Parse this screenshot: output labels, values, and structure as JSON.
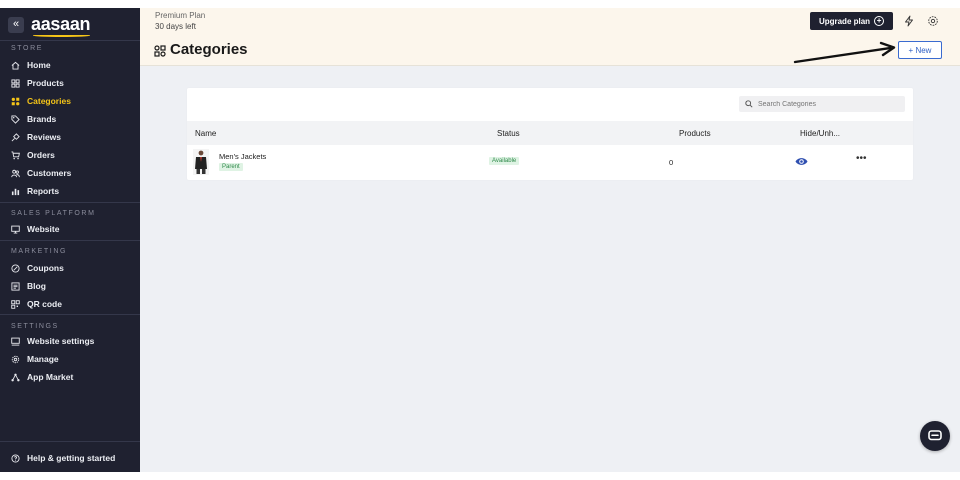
{
  "sidebar": {
    "logo": "aasaan",
    "collapse_icon": "«",
    "sections": [
      {
        "title": "STORE"
      },
      {
        "title": "SALES PLATFORM"
      },
      {
        "title": "MARKETING"
      },
      {
        "title": "SETTINGS"
      }
    ],
    "items": [
      {
        "label": "Home",
        "icon": "home-icon"
      },
      {
        "label": "Products",
        "icon": "products-icon"
      },
      {
        "label": "Categories",
        "icon": "categories-icon",
        "active": true
      },
      {
        "label": "Brands",
        "icon": "tag-icon"
      },
      {
        "label": "Reviews",
        "icon": "reviews-icon"
      },
      {
        "label": "Orders",
        "icon": "cart-icon"
      },
      {
        "label": "Customers",
        "icon": "customers-icon"
      },
      {
        "label": "Reports",
        "icon": "reports-icon"
      },
      {
        "label": "Website",
        "icon": "monitor-icon"
      },
      {
        "label": "Coupons",
        "icon": "coupon-icon"
      },
      {
        "label": "Blog",
        "icon": "blog-icon"
      },
      {
        "label": "QR code",
        "icon": "qr-icon"
      },
      {
        "label": "Website settings",
        "icon": "website-settings-icon"
      },
      {
        "label": "Manage",
        "icon": "gear-icon"
      },
      {
        "label": "App Market",
        "icon": "app-market-icon"
      }
    ],
    "help": {
      "label": "Help & getting started",
      "icon": "help-icon"
    }
  },
  "topbar": {
    "plan_name": "Premium Plan",
    "plan_days": "30 days left",
    "upgrade_label": "Upgrade plan",
    "upgrade_plus": "+"
  },
  "page": {
    "title": "Categories",
    "new_button": "+ New"
  },
  "table": {
    "search_placeholder": "Search Categories",
    "columns": [
      "Name",
      "Status",
      "Products",
      "Hide/Unh..."
    ],
    "rows": [
      {
        "name": "Men's Jackets",
        "badge": "Parent",
        "status": "Available",
        "products": "0",
        "more": "•••"
      }
    ]
  },
  "colors": {
    "sidebar_bg": "#1f2130",
    "accent_yellow": "#f5c518",
    "topbar_bg": "#fcf6ec",
    "primary_blue": "#2f5fc4",
    "badge_green": "#2f8a4a"
  }
}
